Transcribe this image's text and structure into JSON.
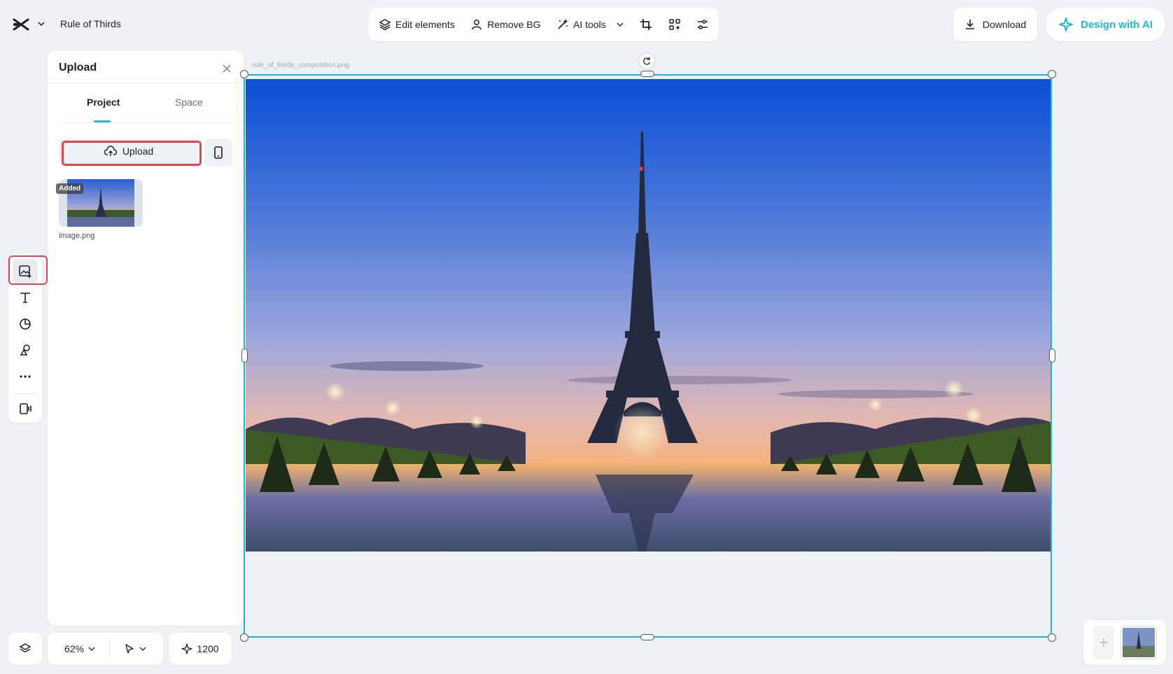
{
  "header": {
    "doc_title": "Rule of Thirds"
  },
  "toolbar": {
    "edit_elements": "Edit elements",
    "remove_bg": "Remove BG",
    "ai_tools": "AI tools"
  },
  "actions": {
    "download": "Download",
    "design_with_ai": "Design with AI"
  },
  "panel": {
    "title": "Upload",
    "tabs": [
      "Project",
      "Space"
    ],
    "upload_label": "Upload",
    "asset": {
      "badge": "Added",
      "name": "image.png"
    }
  },
  "canvas": {
    "filename": "rule_of_thirds_composition.png"
  },
  "bottom": {
    "zoom": "62%",
    "counter": "1200"
  },
  "colors": {
    "accent": "#1fb7d6",
    "highlight": "#e0474c"
  },
  "icons": {
    "logo": "capcut-logo-icon",
    "rail": [
      "image-upload-icon",
      "text-icon",
      "sticker-icon",
      "shapes-icon",
      "more-icon",
      "video-icon"
    ]
  }
}
